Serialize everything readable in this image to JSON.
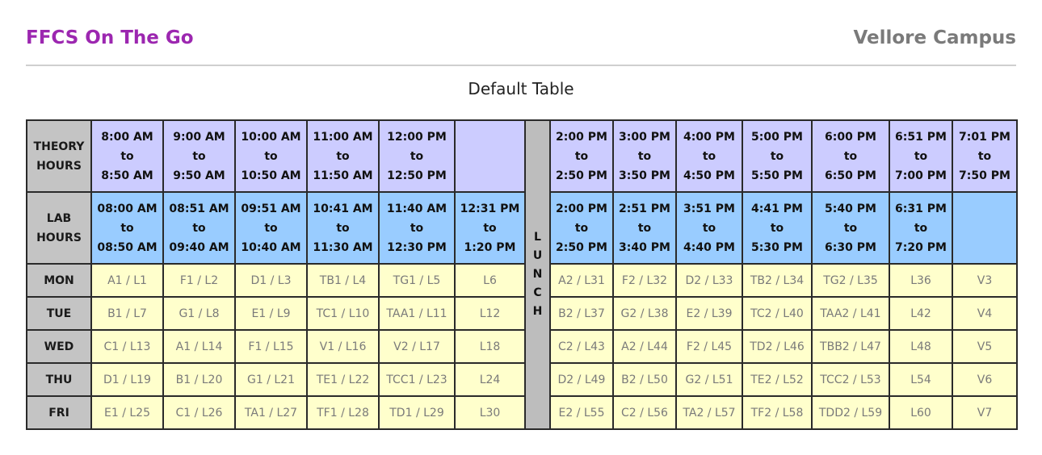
{
  "header": {
    "brand": "FFCS On The Go",
    "campus": "Vellore Campus"
  },
  "table_title": "Default Table",
  "theory": {
    "label_line1": "THEORY",
    "label_line2": "HOURS",
    "slots": [
      {
        "start": "8:00 AM",
        "sep": "to",
        "end": "8:50 AM"
      },
      {
        "start": "9:00 AM",
        "sep": "to",
        "end": "9:50 AM"
      },
      {
        "start": "10:00 AM",
        "sep": "to",
        "end": "10:50 AM"
      },
      {
        "start": "11:00 AM",
        "sep": "to",
        "end": "11:50 AM"
      },
      {
        "start": "12:00 PM",
        "sep": "to",
        "end": "12:50 PM"
      },
      {
        "start": "",
        "sep": "",
        "end": ""
      },
      {
        "start": "2:00 PM",
        "sep": "to",
        "end": "2:50 PM"
      },
      {
        "start": "3:00 PM",
        "sep": "to",
        "end": "3:50 PM"
      },
      {
        "start": "4:00 PM",
        "sep": "to",
        "end": "4:50 PM"
      },
      {
        "start": "5:00 PM",
        "sep": "to",
        "end": "5:50 PM"
      },
      {
        "start": "6:00 PM",
        "sep": "to",
        "end": "6:50 PM"
      },
      {
        "start": "6:51 PM",
        "sep": "to",
        "end": "7:00 PM"
      },
      {
        "start": "7:01 PM",
        "sep": "to",
        "end": "7:50 PM"
      }
    ]
  },
  "lab": {
    "label_line1": "LAB",
    "label_line2": "HOURS",
    "slots": [
      {
        "start": "08:00 AM",
        "sep": "to",
        "end": "08:50 AM"
      },
      {
        "start": "08:51 AM",
        "sep": "to",
        "end": "09:40 AM"
      },
      {
        "start": "09:51 AM",
        "sep": "to",
        "end": "10:40 AM"
      },
      {
        "start": "10:41 AM",
        "sep": "to",
        "end": "11:30 AM"
      },
      {
        "start": "11:40 AM",
        "sep": "to",
        "end": "12:30 PM"
      },
      {
        "start": "12:31 PM",
        "sep": "to",
        "end": "1:20 PM"
      },
      {
        "start": "2:00 PM",
        "sep": "to",
        "end": "2:50 PM"
      },
      {
        "start": "2:51 PM",
        "sep": "to",
        "end": "3:40 PM"
      },
      {
        "start": "3:51 PM",
        "sep": "to",
        "end": "4:40 PM"
      },
      {
        "start": "4:41 PM",
        "sep": "to",
        "end": "5:30 PM"
      },
      {
        "start": "5:40 PM",
        "sep": "to",
        "end": "6:30 PM"
      },
      {
        "start": "6:31 PM",
        "sep": "to",
        "end": "7:20 PM"
      },
      {
        "start": "",
        "sep": "",
        "end": ""
      }
    ]
  },
  "lunch_letters": [
    "L",
    "U",
    "N",
    "C",
    "H"
  ],
  "days": [
    {
      "name": "MON",
      "slots": [
        "A1 / L1",
        "F1 / L2",
        "D1 / L3",
        "TB1 / L4",
        "TG1 / L5",
        "L6",
        "A2 / L31",
        "F2 / L32",
        "D2 / L33",
        "TB2 / L34",
        "TG2 / L35",
        "L36",
        "V3"
      ]
    },
    {
      "name": "TUE",
      "slots": [
        "B1 / L7",
        "G1 / L8",
        "E1 / L9",
        "TC1 / L10",
        "TAA1 / L11",
        "L12",
        "B2 / L37",
        "G2 / L38",
        "E2 / L39",
        "TC2 / L40",
        "TAA2 / L41",
        "L42",
        "V4"
      ]
    },
    {
      "name": "WED",
      "slots": [
        "C1 / L13",
        "A1 / L14",
        "F1 / L15",
        "V1 / L16",
        "V2 / L17",
        "L18",
        "C2 / L43",
        "A2 / L44",
        "F2 / L45",
        "TD2 / L46",
        "TBB2 / L47",
        "L48",
        "V5"
      ]
    },
    {
      "name": "THU",
      "slots": [
        "D1 / L19",
        "B1 / L20",
        "G1 / L21",
        "TE1 / L22",
        "TCC1 / L23",
        "L24",
        "D2 / L49",
        "B2 / L50",
        "G2 / L51",
        "TE2 / L52",
        "TCC2 / L53",
        "L54",
        "V6"
      ]
    },
    {
      "name": "FRI",
      "slots": [
        "E1 / L25",
        "C1 / L26",
        "TA1 / L27",
        "TF1 / L28",
        "TD1 / L29",
        "L30",
        "E2 / L55",
        "C2 / L56",
        "TA2 / L57",
        "TF2 / L58",
        "TDD2 / L59",
        "L60",
        "V7"
      ]
    }
  ],
  "colors": {
    "brand": "#9c27b0",
    "theory_bg": "#ccccff",
    "lab_bg": "#99ccff",
    "slot_bg": "#ffffcc",
    "header_bg": "#c4c4c4"
  }
}
